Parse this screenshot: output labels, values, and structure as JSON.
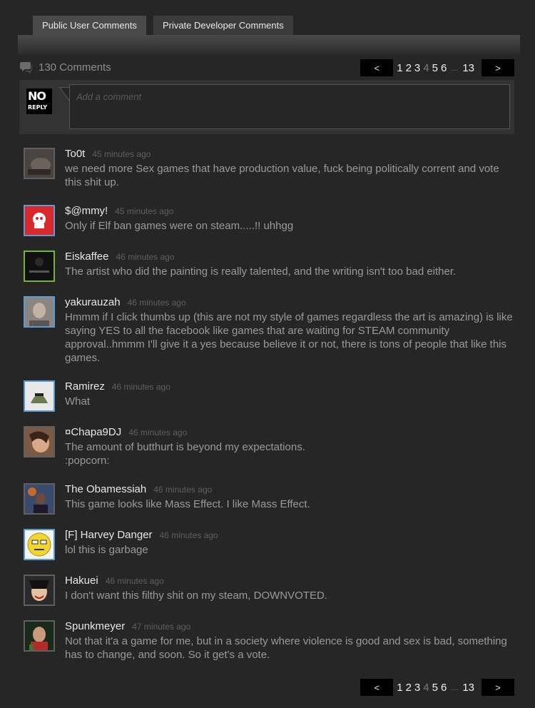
{
  "tabs": [
    {
      "label": "Public User Comments"
    },
    {
      "label": "Private Developer Comments"
    }
  ],
  "header": {
    "comment_count": "130 Comments",
    "icon": "comments-icon"
  },
  "pagination": {
    "prev": "<",
    "next": ">",
    "pages": [
      "1",
      "2",
      "3",
      "4",
      "5",
      "6"
    ],
    "current": "4",
    "ellipsis": "...",
    "last": "13"
  },
  "compose": {
    "avatar_top": "NO",
    "avatar_bottom": "REPLY",
    "placeholder": "Add a comment"
  },
  "comments": [
    {
      "author": "To0t",
      "time": "45 minutes ago",
      "text": "we need more Sex games that have production value, fuck being politically corrent and vote this shit up."
    },
    {
      "author": "$@mmy!",
      "time": "45 minutes ago",
      "text": "Only if Elf ban games were on steam.....!! uhhgg"
    },
    {
      "author": "Eiskaffee",
      "time": "46 minutes ago",
      "text": "The artist who did the painting is really talented, and the writing isn't too bad either."
    },
    {
      "author": "yakurauzah",
      "time": "46 minutes ago",
      "text": "Hmmm if I click thumbs up (this are not my style of games regardless the art is amazing) is like saying YES to all the facebook like games that are waiting for STEAM community approval..hmmm I'll give it a yes because believe it or not, there is tons of people that like this games."
    },
    {
      "author": "Ramirez",
      "time": "46 minutes ago",
      "text": "What"
    },
    {
      "author": "¤Chapa9DJ",
      "time": "46 minutes ago",
      "text": "The amount of butthurt is beyond my expectations.\n:popcorn:"
    },
    {
      "author": "The Obamessiah",
      "time": "46 minutes ago",
      "text": "This game looks like Mass Effect. I like Mass Effect."
    },
    {
      "author": "[F] Harvey Danger",
      "time": "46 minutes ago",
      "text": "lol this is garbage"
    },
    {
      "author": "Hakuei",
      "time": "46 minutes ago",
      "text": "I don't want this filthy shit on my steam, DOWNVOTED."
    },
    {
      "author": "Spunkmeyer",
      "time": "47 minutes ago",
      "text": "Not that it'a a game for me, but in a society where violence is good and sex is bad, something has to change, and soon. So it get's a vote."
    }
  ],
  "colors": {
    "background": "#262627",
    "online_border": "#5b9bd5",
    "ingame_border": "#77b52e",
    "offline_border": "#5f5f5f"
  }
}
